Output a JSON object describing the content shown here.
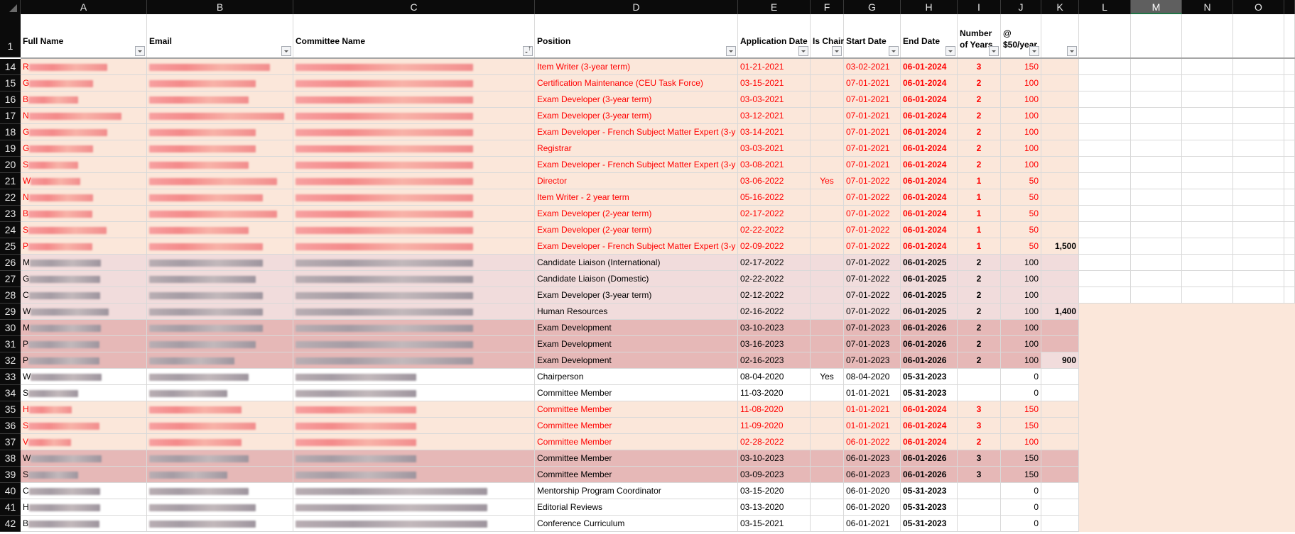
{
  "columns": [
    "A",
    "B",
    "C",
    "D",
    "E",
    "F",
    "G",
    "H",
    "I",
    "J",
    "K",
    "L",
    "M",
    "N",
    "O"
  ],
  "selected_column": "M",
  "header_row_number": "1",
  "headers": {
    "A": "Full Name",
    "B": "Email",
    "C": "Committee Name",
    "D": "Position",
    "E": "Application Date",
    "F": "Is Chair",
    "G": "Start Date",
    "H": "End Date",
    "I": "Number\nof Years",
    "J": "@\n$50/year",
    "K": ""
  },
  "filter_columns": [
    "A",
    "B",
    "C",
    "D",
    "E",
    "F",
    "G",
    "H",
    "I",
    "J",
    "K"
  ],
  "sorted_column": "C",
  "redacted_note": "Full Name, Email and Committee Name values are blurred/redacted",
  "colors": {
    "peach": "#fbe7da",
    "light_pink": "#f1dcdc",
    "pink": "#e6b8b7",
    "expired_text": "#ff0000"
  },
  "rows": [
    {
      "num": "14",
      "fill": "peach",
      "red": true,
      "name_initial": "R",
      "position": "Item Writer (3-year term)",
      "app_date": "01-21-2021",
      "is_chair": "",
      "start": "03-02-2021",
      "end": "06-01-2024",
      "years": "3",
      "amount": "150",
      "subtotal": ""
    },
    {
      "num": "15",
      "fill": "peach",
      "red": true,
      "name_initial": "G",
      "position": "Certification Maintenance (CEU Task Force)",
      "app_date": "03-15-2021",
      "is_chair": "",
      "start": "07-01-2021",
      "end": "06-01-2024",
      "years": "2",
      "amount": "100",
      "subtotal": ""
    },
    {
      "num": "16",
      "fill": "peach",
      "red": true,
      "name_initial": "B",
      "position": "Exam Developer (3-year term)",
      "app_date": "03-03-2021",
      "is_chair": "",
      "start": "07-01-2021",
      "end": "06-01-2024",
      "years": "2",
      "amount": "100",
      "subtotal": ""
    },
    {
      "num": "17",
      "fill": "peach",
      "red": true,
      "name_initial": "N",
      "position": "Exam Developer (3-year term)",
      "app_date": "03-12-2021",
      "is_chair": "",
      "start": "07-01-2021",
      "end": "06-01-2024",
      "years": "2",
      "amount": "100",
      "subtotal": ""
    },
    {
      "num": "18",
      "fill": "peach",
      "red": true,
      "name_initial": "G",
      "position": "Exam Developer - French Subject Matter Expert (3-y",
      "app_date": "03-14-2021",
      "is_chair": "",
      "start": "07-01-2021",
      "end": "06-01-2024",
      "years": "2",
      "amount": "100",
      "subtotal": ""
    },
    {
      "num": "19",
      "fill": "peach",
      "red": true,
      "name_initial": "G",
      "position": "Registrar",
      "app_date": "03-03-2021",
      "is_chair": "",
      "start": "07-01-2021",
      "end": "06-01-2024",
      "years": "2",
      "amount": "100",
      "subtotal": ""
    },
    {
      "num": "20",
      "fill": "peach",
      "red": true,
      "name_initial": "S",
      "position": "Exam Developer - French Subject Matter Expert (3-y",
      "app_date": "03-08-2021",
      "is_chair": "",
      "start": "07-01-2021",
      "end": "06-01-2024",
      "years": "2",
      "amount": "100",
      "subtotal": ""
    },
    {
      "num": "21",
      "fill": "peach",
      "red": true,
      "name_initial": "W",
      "position": "Director",
      "app_date": "03-06-2022",
      "is_chair": "Yes",
      "start": "07-01-2022",
      "end": "06-01-2024",
      "years": "1",
      "amount": "50",
      "subtotal": ""
    },
    {
      "num": "22",
      "fill": "peach",
      "red": true,
      "name_initial": "N",
      "position": "Item Writer - 2 year term",
      "app_date": "05-16-2022",
      "is_chair": "",
      "start": "07-01-2022",
      "end": "06-01-2024",
      "years": "1",
      "amount": "50",
      "subtotal": ""
    },
    {
      "num": "23",
      "fill": "peach",
      "red": true,
      "name_initial": "B",
      "position": "Exam Developer (2-year term)",
      "app_date": "02-17-2022",
      "is_chair": "",
      "start": "07-01-2022",
      "end": "06-01-2024",
      "years": "1",
      "amount": "50",
      "subtotal": ""
    },
    {
      "num": "24",
      "fill": "peach",
      "red": true,
      "name_initial": "S",
      "position": "Exam Developer (2-year term)",
      "app_date": "02-22-2022",
      "is_chair": "",
      "start": "07-01-2022",
      "end": "06-01-2024",
      "years": "1",
      "amount": "50",
      "subtotal": ""
    },
    {
      "num": "25",
      "fill": "peach",
      "red": true,
      "name_initial": "P",
      "position": "Exam Developer - French Subject Matter Expert (3-y",
      "app_date": "02-09-2022",
      "is_chair": "",
      "start": "07-01-2022",
      "end": "06-01-2024",
      "years": "1",
      "amount": "50",
      "subtotal": "1,500"
    },
    {
      "num": "26",
      "fill": "lpink",
      "red": false,
      "name_initial": "M",
      "position": "Candidate Liaison (International)",
      "app_date": "02-17-2022",
      "is_chair": "",
      "start": "07-01-2022",
      "end": "06-01-2025",
      "years": "2",
      "amount": "100",
      "subtotal": ""
    },
    {
      "num": "27",
      "fill": "lpink",
      "red": false,
      "name_initial": "G",
      "position": "Candidate Liaison (Domestic)",
      "app_date": "02-22-2022",
      "is_chair": "",
      "start": "07-01-2022",
      "end": "06-01-2025",
      "years": "2",
      "amount": "100",
      "subtotal": ""
    },
    {
      "num": "28",
      "fill": "lpink",
      "red": false,
      "name_initial": "C",
      "position": "Exam Developer (3-year term)",
      "app_date": "02-12-2022",
      "is_chair": "",
      "start": "07-01-2022",
      "end": "06-01-2025",
      "years": "2",
      "amount": "100",
      "subtotal": ""
    },
    {
      "num": "29",
      "fill": "lpink",
      "red": false,
      "name_initial": "W",
      "position": "Human Resources",
      "app_date": "02-16-2022",
      "is_chair": "",
      "start": "07-01-2022",
      "end": "06-01-2025",
      "years": "2",
      "amount": "100",
      "subtotal": "1,400"
    },
    {
      "num": "30",
      "fill": "pink",
      "red": false,
      "name_initial": "M",
      "position": "Exam Development",
      "app_date": "03-10-2023",
      "is_chair": "",
      "start": "07-01-2023",
      "end": "06-01-2026",
      "years": "2",
      "amount": "100",
      "subtotal": ""
    },
    {
      "num": "31",
      "fill": "pink",
      "red": false,
      "name_initial": "P",
      "position": "Exam Development",
      "app_date": "03-16-2023",
      "is_chair": "",
      "start": "07-01-2023",
      "end": "06-01-2026",
      "years": "2",
      "amount": "100",
      "subtotal": ""
    },
    {
      "num": "32",
      "fill": "pink",
      "red": false,
      "name_initial": "P",
      "position": "Exam Development",
      "app_date": "02-16-2023",
      "is_chair": "",
      "start": "07-01-2023",
      "end": "06-01-2026",
      "years": "2",
      "amount": "100",
      "subtotal": "900",
      "subtotal_fill": "lpink"
    },
    {
      "num": "33",
      "fill": "white",
      "red": false,
      "name_initial": "W",
      "position": "Chairperson",
      "app_date": "08-04-2020",
      "is_chair": "Yes",
      "start": "08-04-2020",
      "end": "05-31-2023",
      "years": "",
      "amount": "0",
      "subtotal": ""
    },
    {
      "num": "34",
      "fill": "white",
      "red": false,
      "name_initial": "S",
      "position": "Committee Member",
      "app_date": "11-03-2020",
      "is_chair": "",
      "start": "01-01-2021",
      "end": "05-31-2023",
      "years": "",
      "amount": "0",
      "subtotal": ""
    },
    {
      "num": "35",
      "fill": "peach",
      "red": true,
      "name_initial": "H",
      "position": "Committee Member",
      "app_date": "11-08-2020",
      "is_chair": "",
      "start": "01-01-2021",
      "end": "06-01-2024",
      "years": "3",
      "amount": "150",
      "subtotal": ""
    },
    {
      "num": "36",
      "fill": "peach",
      "red": true,
      "name_initial": "S",
      "position": "Committee Member",
      "app_date": "11-09-2020",
      "is_chair": "",
      "start": "01-01-2021",
      "end": "06-01-2024",
      "years": "3",
      "amount": "150",
      "subtotal": ""
    },
    {
      "num": "37",
      "fill": "peach",
      "red": true,
      "name_initial": "V",
      "position": "Committee Member",
      "app_date": "02-28-2022",
      "is_chair": "",
      "start": "06-01-2022",
      "end": "06-01-2024",
      "years": "2",
      "amount": "100",
      "subtotal": ""
    },
    {
      "num": "38",
      "fill": "pink",
      "red": false,
      "name_initial": "W",
      "position": "Committee Member",
      "app_date": "03-10-2023",
      "is_chair": "",
      "start": "06-01-2023",
      "end": "06-01-2026",
      "years": "3",
      "amount": "150",
      "subtotal": ""
    },
    {
      "num": "39",
      "fill": "pink",
      "red": false,
      "name_initial": "S",
      "position": "Committee Member",
      "app_date": "03-09-2023",
      "is_chair": "",
      "start": "06-01-2023",
      "end": "06-01-2026",
      "years": "3",
      "amount": "150",
      "subtotal": ""
    },
    {
      "num": "40",
      "fill": "white",
      "red": false,
      "name_initial": "C",
      "position": "Mentorship Program Coordinator",
      "app_date": "03-15-2020",
      "is_chair": "",
      "start": "06-01-2020",
      "end": "05-31-2023",
      "years": "",
      "amount": "0",
      "subtotal": ""
    },
    {
      "num": "41",
      "fill": "white",
      "red": false,
      "name_initial": "H",
      "position": "Editorial Reviews",
      "app_date": "03-13-2020",
      "is_chair": "",
      "start": "06-01-2020",
      "end": "05-31-2023",
      "years": "",
      "amount": "0",
      "subtotal": ""
    },
    {
      "num": "42",
      "fill": "white",
      "red": false,
      "name_initial": "B",
      "position": "Conference Curriculum",
      "app_date": "03-15-2021",
      "is_chair": "",
      "start": "06-01-2021",
      "end": "05-31-2023",
      "years": "",
      "amount": "0",
      "subtotal": ""
    }
  ]
}
